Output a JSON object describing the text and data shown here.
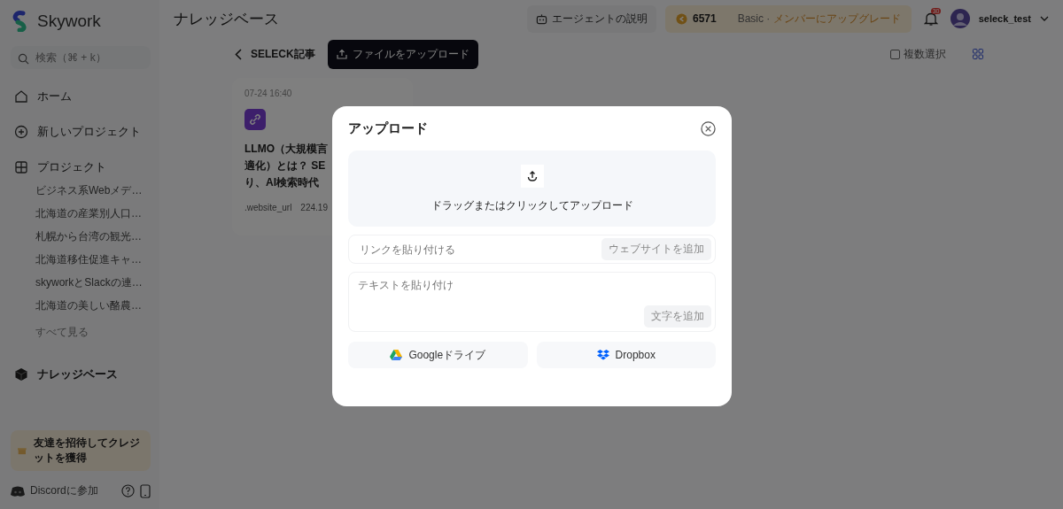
{
  "app": {
    "name": "Skywork"
  },
  "sidebar": {
    "search": {
      "placeholder": "検索（⌘ + k）"
    },
    "nav": [
      {
        "label": "ホーム",
        "kind": "home"
      },
      {
        "label": "新しいプロジェクト",
        "kind": "new"
      },
      {
        "label": "プロジェクト",
        "kind": "projects"
      }
    ],
    "projects": [
      "ビジネス系Webメデ…",
      "北海道の産業別人口…",
      "札幌から台湾の観光…",
      "北海道移住促進キャ…",
      "skyworkとSlackの連…",
      "北海道の美しい酪農…"
    ],
    "see_all": "すべて見る",
    "knowledge": {
      "label": "ナレッジベース",
      "selected": true
    },
    "invite": "友達を招待してクレジットを獲得",
    "discord": "Discordに参加"
  },
  "header": {
    "title": "ナレッジベース",
    "agent_button": "エージェントの説明",
    "credits": "6571",
    "plan": "Basic",
    "separator": "·",
    "upgrade": "メンバーにアップグレード",
    "notifications": "30",
    "user": "seleck_test"
  },
  "toolbar": {
    "back_label": "SELECK記事",
    "upload_button": "ファイルをアップロード",
    "multi_select": {
      "label": "複数選択",
      "checked": false
    }
  },
  "cards": [
    {
      "time": "07-24 16:40",
      "title_lines": [
        "LLMO（大規模言",
        "適化）とは？ SE",
        "り、AI検索時代"
      ],
      "source": ".website_url",
      "size": "224.19"
    }
  ],
  "modal": {
    "title": "アップロード",
    "dropzone": "ドラッグまたはクリックしてアップロード",
    "link_field": {
      "placeholder": "リンクを貼り付ける"
    },
    "add_website": "ウェブサイトを追加",
    "text_field": {
      "placeholder": "テキストを貼り付け"
    },
    "add_text": "文字を追加",
    "sources": [
      {
        "label": "Googleドライブ",
        "kind": "google"
      },
      {
        "label": "Dropbox",
        "kind": "dropbox"
      }
    ]
  }
}
